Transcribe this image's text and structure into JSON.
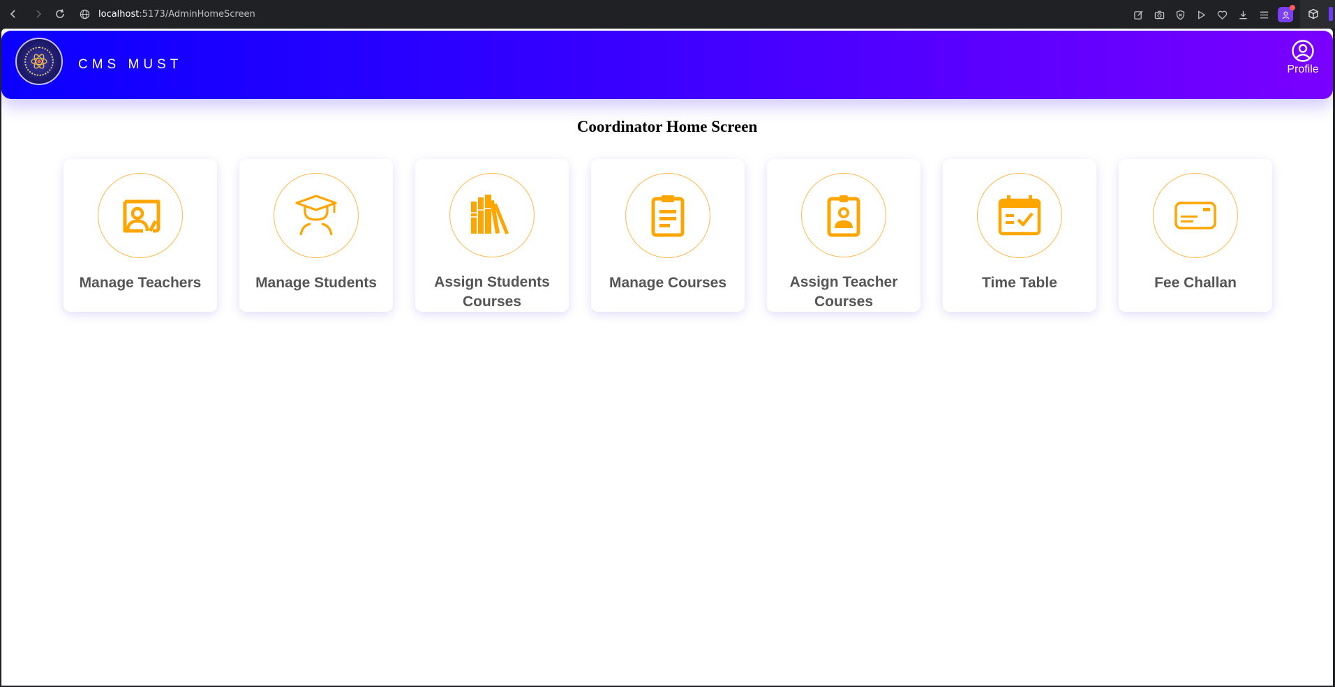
{
  "browser": {
    "url_host": "localhost",
    "url_path": ":5173/AdminHomeScreen"
  },
  "header": {
    "brand": "CMS MUST",
    "profile_label": "Profile"
  },
  "main": {
    "title": "Coordinator Home Screen",
    "cards": [
      {
        "label": "Manage Teachers",
        "icon": "teacher-icon"
      },
      {
        "label": "Manage Students",
        "icon": "student-icon"
      },
      {
        "label": "Assign Students Courses",
        "icon": "books-icon"
      },
      {
        "label": "Manage Courses",
        "icon": "clipboard-icon"
      },
      {
        "label": "Assign Teacher Courses",
        "icon": "id-badge-icon"
      },
      {
        "label": "Time Table",
        "icon": "calendar-check-icon"
      },
      {
        "label": "Fee Challan",
        "icon": "card-icon"
      }
    ]
  },
  "colors": {
    "accent": "#ffa500",
    "header_start": "#0a00ff",
    "header_end": "#7a00ff",
    "card_text": "#555555"
  }
}
